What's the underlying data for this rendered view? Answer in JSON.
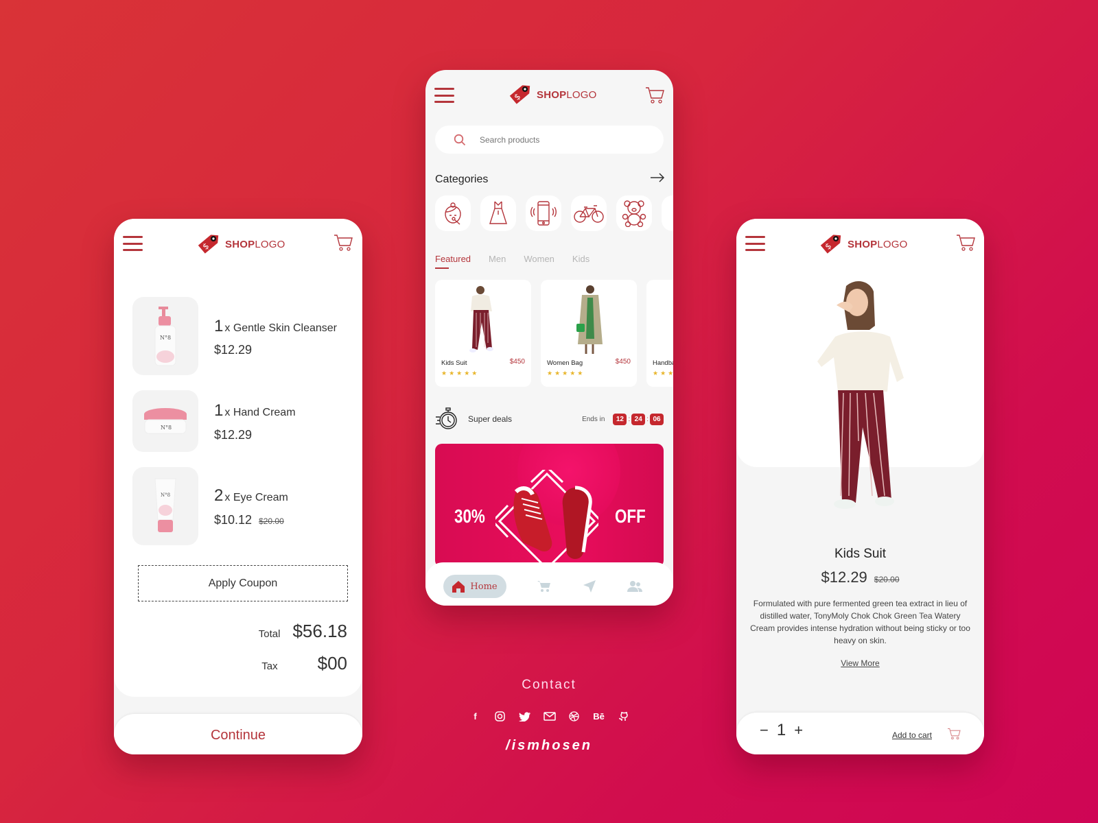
{
  "brand": {
    "bold": "SHOP",
    "light": "LOGO",
    "accent": "#b4353b"
  },
  "cart_screen": {
    "items": [
      {
        "qty": "1",
        "unit": "x",
        "name": "Gentle Skin Cleanser",
        "price": "$12.29",
        "old_price": null,
        "image": "pump-bottle"
      },
      {
        "qty": "1",
        "unit": "x",
        "name": "Hand Cream",
        "price": "$12.29",
        "old_price": null,
        "image": "cream-jar"
      },
      {
        "qty": "2",
        "unit": "x",
        "name": "Eye Cream",
        "price": "$10.12",
        "old_price": "$20.00",
        "image": "cream-tube"
      }
    ],
    "coupon_label": "Apply Coupon",
    "total_label": "Total",
    "total_value": "$56.18",
    "tax_label": "Tax",
    "tax_value": "$00",
    "continue_label": "Continue"
  },
  "home_screen": {
    "search_placeholder": "Search products",
    "categories_title": "Categories",
    "categories": [
      "beauty",
      "dress",
      "phone",
      "bicycle",
      "teddy-bear"
    ],
    "tabs": [
      "Featured",
      "Men",
      "Women",
      "Kids"
    ],
    "active_tab": "Featured",
    "products": [
      {
        "name": "Kids Suit",
        "price": "$450",
        "rating": 5
      },
      {
        "name": "Women Bag",
        "price": "$450",
        "rating": 5
      },
      {
        "name": "Handbag",
        "price": "",
        "rating": 5
      }
    ],
    "deals_label": "Super deals",
    "ends_in_label": "Ends in",
    "timer": {
      "h": "12",
      "m": "24",
      "s": "06"
    },
    "banner": {
      "left": "30%",
      "right": "OFF"
    },
    "nav": {
      "home_label": "Home",
      "items": [
        "cart",
        "send",
        "users"
      ]
    }
  },
  "detail_screen": {
    "title": "Kids Suit",
    "price": "$12.29",
    "old_price": "$20.00",
    "description": "Formulated with pure fermented green tea extract in lieu of distilled water, TonyMoly Chok Chok Green Tea Watery Cream provides intense hydration without being sticky or too heavy on skin.",
    "view_more": "View More",
    "quantity": "1",
    "minus": "−",
    "plus": "+",
    "add_to_cart": "Add to cart"
  },
  "footer": {
    "contact": "Contact",
    "socials": [
      "facebook",
      "instagram",
      "twitter",
      "email",
      "dribbble",
      "behance",
      "github"
    ],
    "behance_text": "Bē",
    "handle": "/ismhosen"
  }
}
